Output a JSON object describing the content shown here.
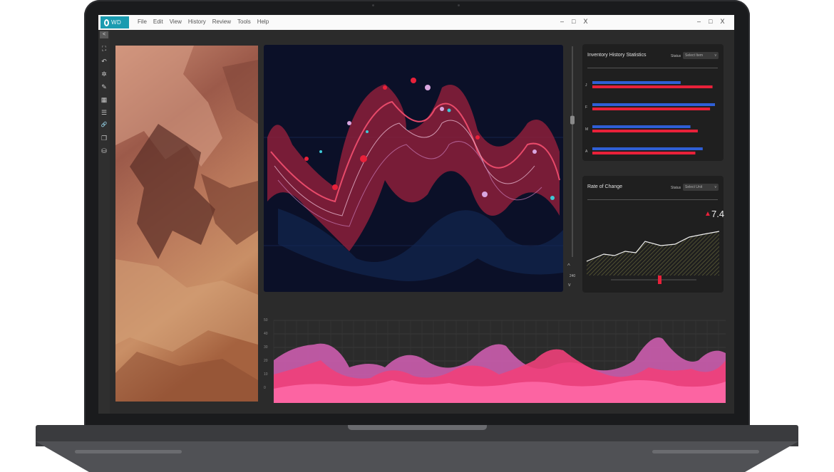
{
  "app": {
    "logo_text": "WD",
    "menu": [
      "File",
      "Edit",
      "View",
      "History",
      "Review",
      "Tools",
      "Help"
    ],
    "inner_window_controls": [
      "–",
      "□",
      "X"
    ],
    "outer_window_controls": [
      "–",
      "□",
      "X"
    ],
    "collapse_glyph": "<"
  },
  "tools": [
    {
      "icon": "expand-icon",
      "glyph": "⛶"
    },
    {
      "icon": "undo-icon",
      "glyph": "↶"
    },
    {
      "icon": "network-icon",
      "glyph": "✲"
    },
    {
      "icon": "brush-icon",
      "glyph": "✎"
    },
    {
      "icon": "grid-icon",
      "glyph": "▦"
    },
    {
      "icon": "list-icon",
      "glyph": "☰"
    },
    {
      "icon": "link-icon",
      "glyph": "🔗"
    },
    {
      "icon": "copy-icon",
      "glyph": "❐"
    },
    {
      "icon": "database-icon",
      "glyph": "⛁"
    }
  ],
  "slider": {
    "value_label": "240",
    "up": "^",
    "down": "v",
    "level": 0.35
  },
  "inventory": {
    "title": "Inventory History Statistics",
    "filter_label": "Status",
    "select_placeholder": "Select Item",
    "rows": [
      {
        "label": "J",
        "blue": 0.72,
        "red": 0.98
      },
      {
        "label": "F",
        "blue": 1.0,
        "red": 0.96
      },
      {
        "label": "M",
        "blue": 0.8,
        "red": 0.86
      },
      {
        "label": "A",
        "blue": 0.9,
        "red": 0.84
      }
    ],
    "colors": {
      "blue": "#2f5fd6",
      "red": "#e8213a"
    }
  },
  "rate": {
    "title": "Rate of Change",
    "filter_label": "Status",
    "select_placeholder": "Select Unit",
    "indicator": "▲",
    "value": "7.4",
    "colors": {
      "up": "#e8213a"
    }
  },
  "bottom_chart": {
    "y_ticks": [
      "50",
      "40",
      "30",
      "20",
      "10",
      "0"
    ],
    "colors": [
      "#d660b6",
      "#f0407a",
      "#ff6aa8"
    ]
  }
}
